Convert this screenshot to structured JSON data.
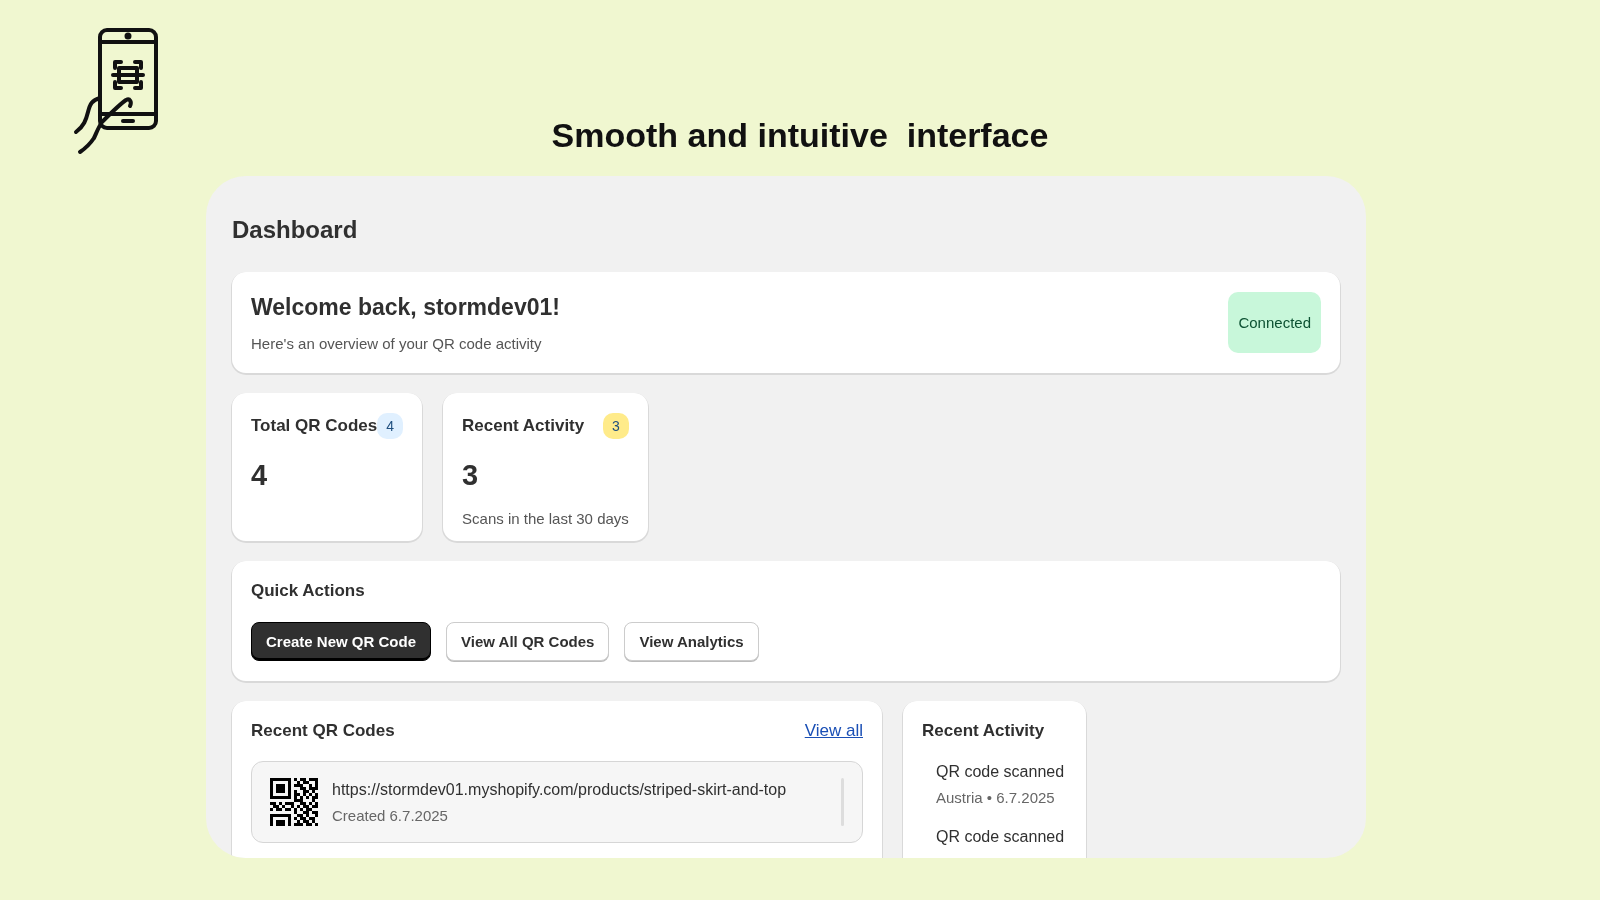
{
  "headline": "Smooth and intuitive  interface",
  "page_title": "Dashboard",
  "welcome": {
    "title": "Welcome back, stormdev01!",
    "subtitle": "Here's an overview of your QR code activity",
    "status": "Connected"
  },
  "stats": [
    {
      "title": "Total QR Codes",
      "badge": "4",
      "color": "#e0f0ff",
      "value": "4"
    },
    {
      "title": "Recent Activity",
      "badge": "3",
      "color": "#ffeb8a",
      "value": "3",
      "note": "Scans in the last 30 days"
    }
  ],
  "quick_actions": {
    "title": "Quick Actions",
    "buttons": [
      {
        "label": "Create New QR Code",
        "kind": "primary"
      },
      {
        "label": "View All QR Codes",
        "kind": "secondary"
      },
      {
        "label": "View Analytics",
        "kind": "secondary"
      }
    ]
  },
  "recent_qr_codes": {
    "title": "Recent QR Codes",
    "link": "View all",
    "items": [
      {
        "url": "https://stormdev01.myshopify.com/products/striped-skirt-and-top",
        "created": "Created 6.7.2025"
      }
    ]
  },
  "recent_activity": {
    "title": "Recent Activity",
    "items": [
      {
        "event": "QR code scanned",
        "detail": "Austria • 6.7.2025"
      },
      {
        "event": "QR code scanned"
      }
    ]
  }
}
